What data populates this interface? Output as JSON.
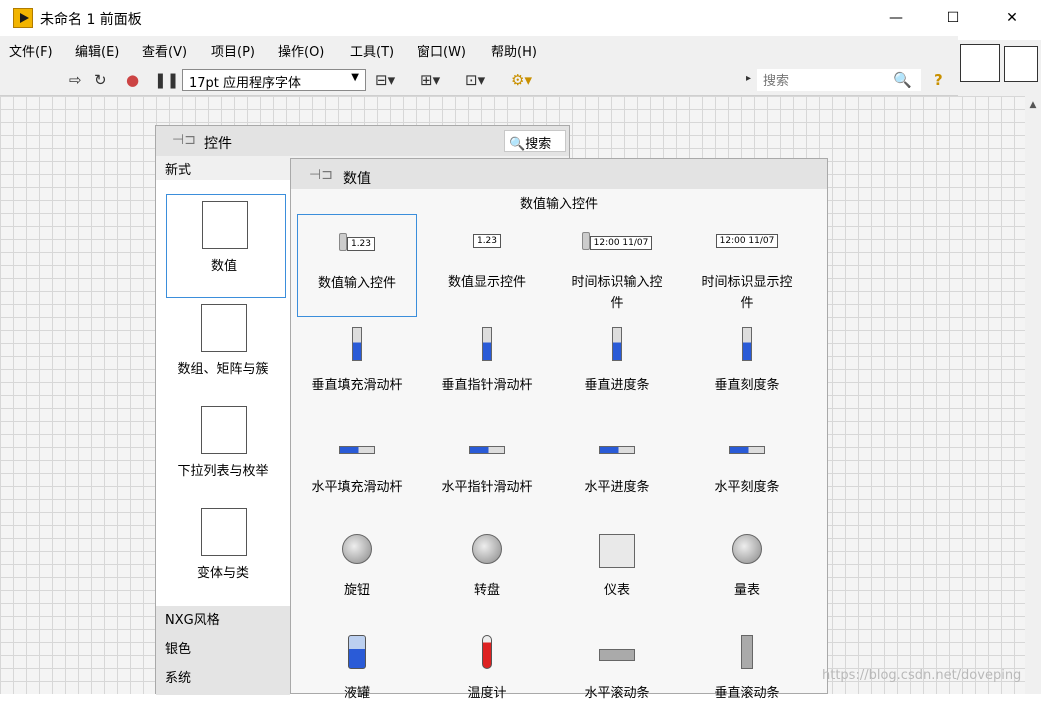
{
  "window": {
    "title": "未命名 1 前面板",
    "minimize": "—",
    "maximize": "☐",
    "close": "✕"
  },
  "menu": [
    "文件(F)",
    "编辑(E)",
    "查看(V)",
    "项目(P)",
    "操作(O)",
    "工具(T)",
    "窗口(W)",
    "帮助(H)"
  ],
  "toolbar": {
    "font_value": "17pt 应用程序字体",
    "search_placeholder": "搜索"
  },
  "controls_palette": {
    "title": "控件",
    "search_button": "搜索",
    "section_label": "新式",
    "categories": [
      "数值",
      "数组、矩阵与簇",
      "下拉列表与枚举",
      "变体与类"
    ],
    "bottom_categories": [
      "NXG风格",
      "银色",
      "系统"
    ]
  },
  "numeric_palette": {
    "title": "数值",
    "subsection": "数值输入控件",
    "items": [
      {
        "label": "数值输入控件",
        "glyph": "1.23"
      },
      {
        "label": "数值显示控件",
        "glyph": "1.23"
      },
      {
        "label": "时间标识输入控\n件",
        "glyph": "12:00 11/07"
      },
      {
        "label": "时间标识显示控\n件",
        "glyph": "12:00 11/07"
      },
      {
        "label": "垂直填充滑动杆"
      },
      {
        "label": "垂直指针滑动杆"
      },
      {
        "label": "垂直进度条"
      },
      {
        "label": "垂直刻度条"
      },
      {
        "label": "水平填充滑动杆"
      },
      {
        "label": "水平指针滑动杆"
      },
      {
        "label": "水平进度条"
      },
      {
        "label": "水平刻度条"
      },
      {
        "label": "旋钮"
      },
      {
        "label": "转盘"
      },
      {
        "label": "仪表"
      },
      {
        "label": "量表"
      },
      {
        "label": "液罐"
      },
      {
        "label": "温度计"
      },
      {
        "label": "水平滚动条"
      },
      {
        "label": "垂直滚动条"
      }
    ]
  },
  "watermark": "https://blog.csdn.net/doveping"
}
